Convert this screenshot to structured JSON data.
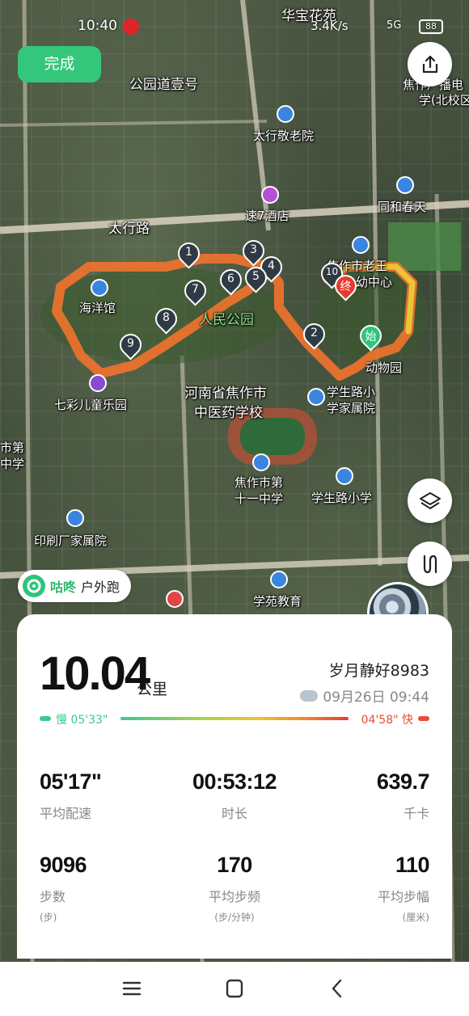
{
  "status_bar": {
    "time": "10:40",
    "net_speed": "3.4K/s",
    "signal": "5G",
    "battery": "88"
  },
  "header": {
    "done_label": "完成",
    "share_icon": "share-icon"
  },
  "map": {
    "labels": {
      "huabao": "华宝花苑",
      "gongyuan_road": "公园道壹号",
      "taihang_elder": "太行敬老院",
      "hotel": "速7酒店",
      "tonghe": "同和春天",
      "taihang_road": "太行路",
      "ocean": "海洋馆",
      "people_park": "人民公园",
      "jiaozuo_zoo": "焦作市老王",
      "zoo_tail": "动物园",
      "school_pre": "幼中心",
      "qicai": "七彩儿童乐园",
      "hospital_school_1": "河南省焦作市",
      "hospital_school_2": "中医药学校",
      "xuesheng_1": "学生路小",
      "xuesheng_2": "学家属院",
      "jiaozuo_11_1": "焦作市第",
      "jiaozuo_11_2": "十一中学",
      "xuesheng_primary": "学生路小学",
      "printing": "印刷厂家属院",
      "xueyuan": "学苑教育",
      "left_school_1": "市第",
      "left_school_2": "中学",
      "broadcast_1": "焦作广播电",
      "broadcast_2": "学(北校区",
      "start_label": "始",
      "end_label": "终"
    },
    "route_markers": [
      "1",
      "2",
      "3",
      "4",
      "5",
      "6",
      "7",
      "8",
      "9",
      "10"
    ]
  },
  "side_buttons": {
    "layers_icon": "layers-icon",
    "pace_curve_icon": "pace-curve-icon"
  },
  "brand": {
    "name": "咕咚",
    "activity_type": "户外跑"
  },
  "summary": {
    "distance": "10.04",
    "distance_unit": "公里",
    "username": "岁月静好8983",
    "date_time": "09月26日 09:44",
    "pace_slow_label": "慢 05'33\"",
    "pace_fast_label": "04'58\" 快",
    "stats": [
      {
        "value": "05'17\"",
        "label": "平均配速",
        "unit": ""
      },
      {
        "value": "00:53:12",
        "label": "时长",
        "unit": ""
      },
      {
        "value": "639.7",
        "label": "千卡",
        "unit": ""
      },
      {
        "value": "9096",
        "label": "步数",
        "unit": "(步)"
      },
      {
        "value": "170",
        "label": "平均步频",
        "unit": "(步/分钟)"
      },
      {
        "value": "110",
        "label": "平均步幅",
        "unit": "(厘米)"
      }
    ]
  },
  "nav_bar": {
    "menu_icon": "menu-icon",
    "home_icon": "home-icon",
    "back_icon": "back-icon"
  }
}
